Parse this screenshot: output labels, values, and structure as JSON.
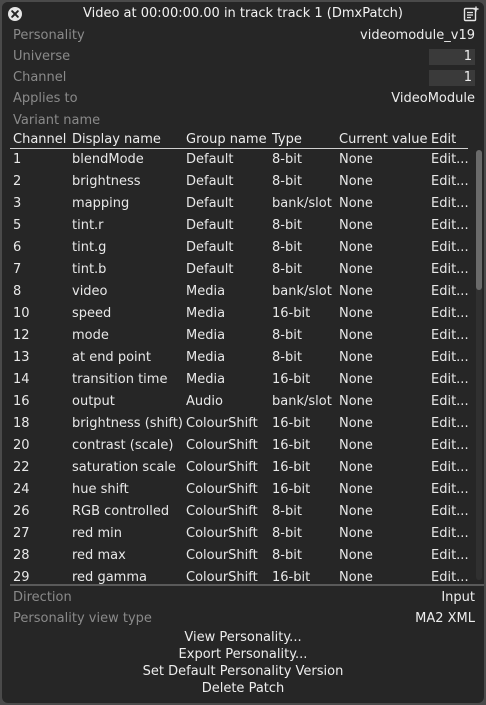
{
  "window": {
    "title": "Video at 00:00:00.00 in track track 1 (DmxPatch)"
  },
  "properties": {
    "personality": {
      "label": "Personality",
      "value": "videomodule_v19"
    },
    "universe": {
      "label": "Universe",
      "value": "1"
    },
    "channel": {
      "label": "Channel",
      "value": "1"
    },
    "applies_to": {
      "label": "Applies to",
      "value": "VideoModule"
    },
    "variant_name": {
      "label": "Variant name"
    }
  },
  "table": {
    "columns": [
      "Channel",
      "Display name",
      "Group name",
      "Type",
      "Current value",
      "Edit"
    ],
    "rows": [
      [
        "1",
        "blendMode",
        "Default",
        "8-bit",
        "None",
        "Edit..."
      ],
      [
        "2",
        "brightness",
        "Default",
        "8-bit",
        "None",
        "Edit..."
      ],
      [
        "3",
        "mapping",
        "Default",
        "bank/slot",
        "None",
        "Edit..."
      ],
      [
        "5",
        "tint.r",
        "Default",
        "8-bit",
        "None",
        "Edit..."
      ],
      [
        "6",
        "tint.g",
        "Default",
        "8-bit",
        "None",
        "Edit..."
      ],
      [
        "7",
        "tint.b",
        "Default",
        "8-bit",
        "None",
        "Edit..."
      ],
      [
        "8",
        "video",
        "Media",
        "bank/slot",
        "None",
        "Edit..."
      ],
      [
        "10",
        "speed",
        "Media",
        "16-bit",
        "None",
        "Edit..."
      ],
      [
        "12",
        "mode",
        "Media",
        "8-bit",
        "None",
        "Edit..."
      ],
      [
        "13",
        "at end point",
        "Media",
        "8-bit",
        "None",
        "Edit..."
      ],
      [
        "14",
        "transition time",
        "Media",
        "16-bit",
        "None",
        "Edit..."
      ],
      [
        "16",
        "output",
        "Audio",
        "bank/slot",
        "None",
        "Edit..."
      ],
      [
        "18",
        "brightness (shift)",
        "ColourShift",
        "16-bit",
        "None",
        "Edit..."
      ],
      [
        "20",
        "contrast (scale)",
        "ColourShift",
        "16-bit",
        "None",
        "Edit..."
      ],
      [
        "22",
        "saturation scale",
        "ColourShift",
        "16-bit",
        "None",
        "Edit..."
      ],
      [
        "24",
        "hue shift",
        "ColourShift",
        "16-bit",
        "None",
        "Edit..."
      ],
      [
        "26",
        "RGB controlled",
        "ColourShift",
        "8-bit",
        "None",
        "Edit..."
      ],
      [
        "27",
        "red min",
        "ColourShift",
        "8-bit",
        "None",
        "Edit..."
      ],
      [
        "28",
        "red max",
        "ColourShift",
        "8-bit",
        "None",
        "Edit..."
      ],
      [
        "29",
        "red gamma",
        "ColourShift",
        "16-bit",
        "None",
        "Edit..."
      ]
    ]
  },
  "footer": {
    "direction": {
      "label": "Direction",
      "value": "Input"
    },
    "view_type": {
      "label": "Personality view type",
      "value": "MA2 XML"
    },
    "actions": {
      "view": "View Personality...",
      "export": "Export Personality...",
      "set_default": "Set Default Personality Version",
      "delete": "Delete Patch"
    }
  },
  "icons": {
    "close": "close-icon",
    "notes": "notes-icon"
  },
  "colors": {
    "background": "#262626",
    "label": "#8a8a8a",
    "text": "#ededed",
    "input": "#3a3a3a"
  }
}
